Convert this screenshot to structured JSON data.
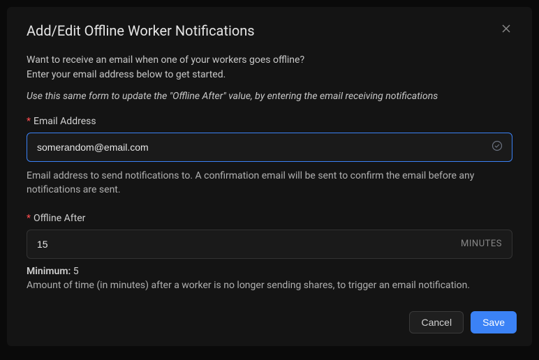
{
  "modal": {
    "title": "Add/Edit Offline Worker Notifications",
    "intro_line1": "Want to receive an email when one of your workers goes offline?",
    "intro_line2": "Enter your email address below to get started.",
    "intro_italic": "Use this same form to update the \"Offline After\" value, by entering the email receiving notifications"
  },
  "email": {
    "label": "Email Address",
    "value": "somerandom@email.com",
    "helper": "Email address to send notifications to. A confirmation email will be sent to confirm the email before any notifications are sent."
  },
  "offline_after": {
    "label": "Offline After",
    "value": "15",
    "unit": "MINUTES",
    "minimum_label": "Minimum:",
    "minimum_value": "5",
    "helper": "Amount of time (in minutes) after a worker is no longer sending shares, to trigger an email notification."
  },
  "buttons": {
    "cancel": "Cancel",
    "save": "Save"
  }
}
